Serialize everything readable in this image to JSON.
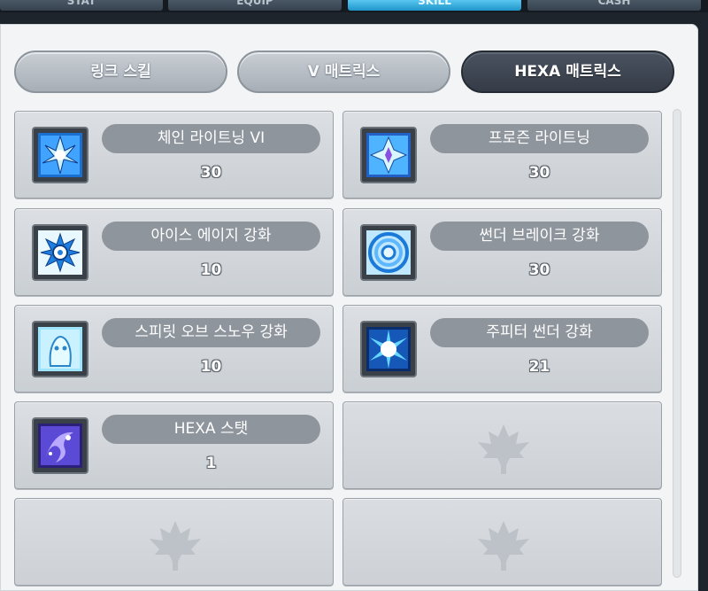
{
  "top_tabs": [
    {
      "label": "STAT",
      "active": false
    },
    {
      "label": "EQUIP",
      "active": false
    },
    {
      "label": "SKILL",
      "active": true
    },
    {
      "label": "CASH",
      "active": false
    }
  ],
  "sub_tabs": [
    {
      "label": "링크 스킬",
      "active": false
    },
    {
      "label": "V 매트릭스",
      "active": false
    },
    {
      "label": "HEXA 매트릭스",
      "active": true
    }
  ],
  "skills": [
    {
      "name": "체인 라이트닝 VI",
      "level": "30",
      "icon": "chain-lightning-icon"
    },
    {
      "name": "프로즌 라이트닝",
      "level": "30",
      "icon": "frozen-lightning-icon"
    },
    {
      "name": "아이스 에이지 강화",
      "level": "10",
      "icon": "ice-age-icon"
    },
    {
      "name": "썬더 브레이크 강화",
      "level": "30",
      "icon": "thunder-break-icon"
    },
    {
      "name": "스피릿 오브 스노우 강화",
      "level": "10",
      "icon": "spirit-of-snow-icon"
    },
    {
      "name": "주피터 썬더 강화",
      "level": "21",
      "icon": "jupiter-thunder-icon"
    },
    {
      "name": "HEXA 스탯",
      "level": "1",
      "icon": "hexa-stat-icon"
    }
  ],
  "empty_slots": 3,
  "colors": {
    "accent": "#1f95c9",
    "pill": "#8e959d",
    "active_tab": "#3a414c"
  }
}
